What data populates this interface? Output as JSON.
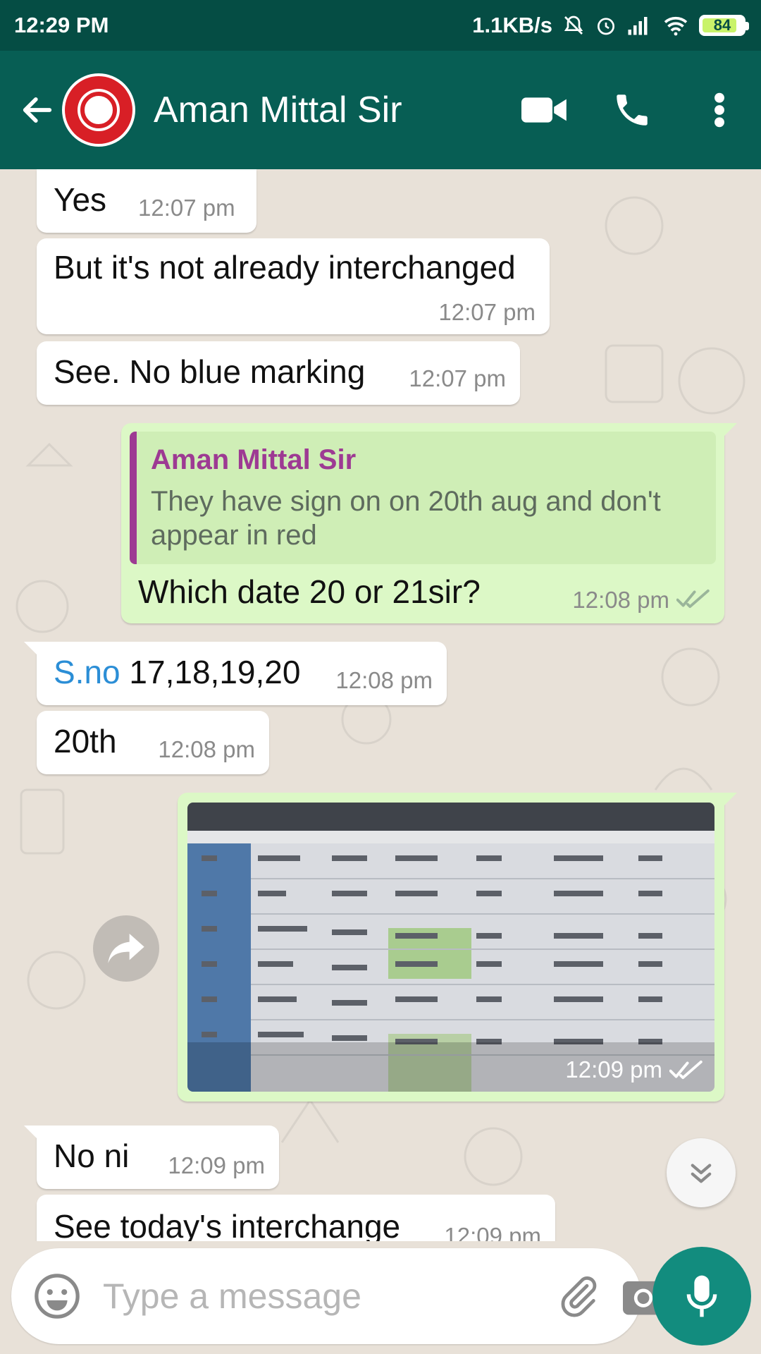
{
  "status_bar": {
    "time": "12:29 PM",
    "network_speed": "1.1KB/s",
    "battery": "84"
  },
  "header": {
    "contact_name": "Aman Mittal Sir"
  },
  "messages": [
    {
      "direction": "in",
      "text": "Yes",
      "time": "12:07 pm"
    },
    {
      "direction": "in",
      "text": "But it's not already interchanged",
      "time": "12:07 pm"
    },
    {
      "direction": "in",
      "text": "See. No blue marking",
      "time": "12:07 pm"
    },
    {
      "direction": "out",
      "quote_name": "Aman Mittal Sir",
      "quote_text": "They have sign on on 20th aug and don't appear in red",
      "text": "Which date 20 or 21sir?",
      "time": "12:08 pm"
    },
    {
      "direction": "in",
      "link_text": "S.no",
      "text": "17,18,19,20",
      "time": "12:08 pm"
    },
    {
      "direction": "in",
      "text": "20th",
      "time": "12:08 pm"
    },
    {
      "direction": "out",
      "type": "image",
      "time": "12:09 pm"
    },
    {
      "direction": "in",
      "text": "No ni",
      "time": "12:09 pm"
    },
    {
      "direction": "in",
      "text": "See today's interchange",
      "time": "12:09 pm"
    }
  ],
  "input": {
    "placeholder": "Type a message",
    "value": ""
  },
  "colors": {
    "status_bar": "#054d44",
    "header": "#075e54",
    "outgoing_bubble": "#dcf8c6",
    "incoming_bubble": "#ffffff",
    "mic_button": "#128c7e",
    "quote_accent": "#9d3a93",
    "link": "#2b8ed6"
  },
  "icons": [
    "back-arrow-icon",
    "video-call-icon",
    "voice-call-icon",
    "more-options-icon",
    "read-receipt-icon",
    "forward-icon",
    "scroll-down-icon",
    "emoji-icon",
    "attach-icon",
    "camera-icon",
    "mic-icon"
  ]
}
